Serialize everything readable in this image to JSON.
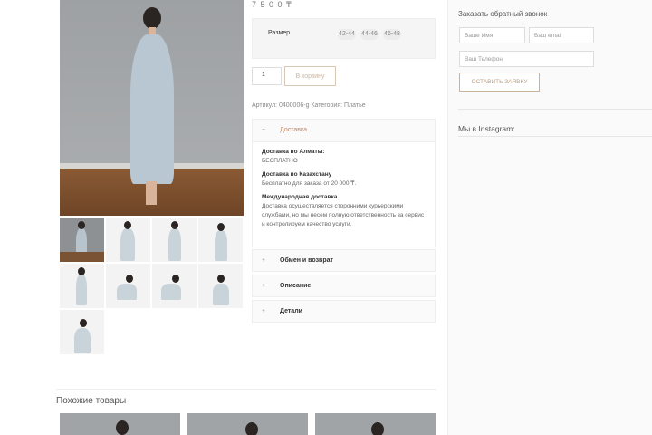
{
  "product": {
    "price_text": "7 5 0 0 ₸"
  },
  "size": {
    "label": "Размер",
    "options": [
      "42-44",
      "44-46",
      "46-48"
    ]
  },
  "cart": {
    "quantity": "1",
    "button_label": "В корзину"
  },
  "meta_text": "Артикул: 0400006-g Категория: Платье",
  "accordion": {
    "delivery_title": "Доставка",
    "delivery_almaty_title": "Доставка по Алматы:",
    "delivery_almaty_text": "БЕСПЛАТНО",
    "delivery_kz_title": "Доставка по Казахстану",
    "delivery_kz_text": "Бесплатно для заказа от 20 000 ₸.",
    "delivery_intl_title": "Международная доставка",
    "delivery_intl_text": "Доставка осуществляется сторонними курьерскими службами, но мы несем полную ответственность за сервис и контролируем качество услуги.",
    "returns_title": "Обмен и возврат",
    "description_title": "Описание",
    "details_title": "Детали",
    "open_sign": "−",
    "closed_sign": "+"
  },
  "sidebar": {
    "callback_title": "Заказать обратный звонок",
    "name_placeholder": "Ваше Имя",
    "email_placeholder": "Ваш email",
    "phone_placeholder": "Ваш Телефон",
    "submit_label": "ОСТАВИТЬ ЗАЯВКУ",
    "instagram_title": "Мы в Instagram:"
  },
  "similar_title": "Похожие товары",
  "colors": {
    "accent": "#c8b49f",
    "sidebar_bg": "#fafafa"
  }
}
